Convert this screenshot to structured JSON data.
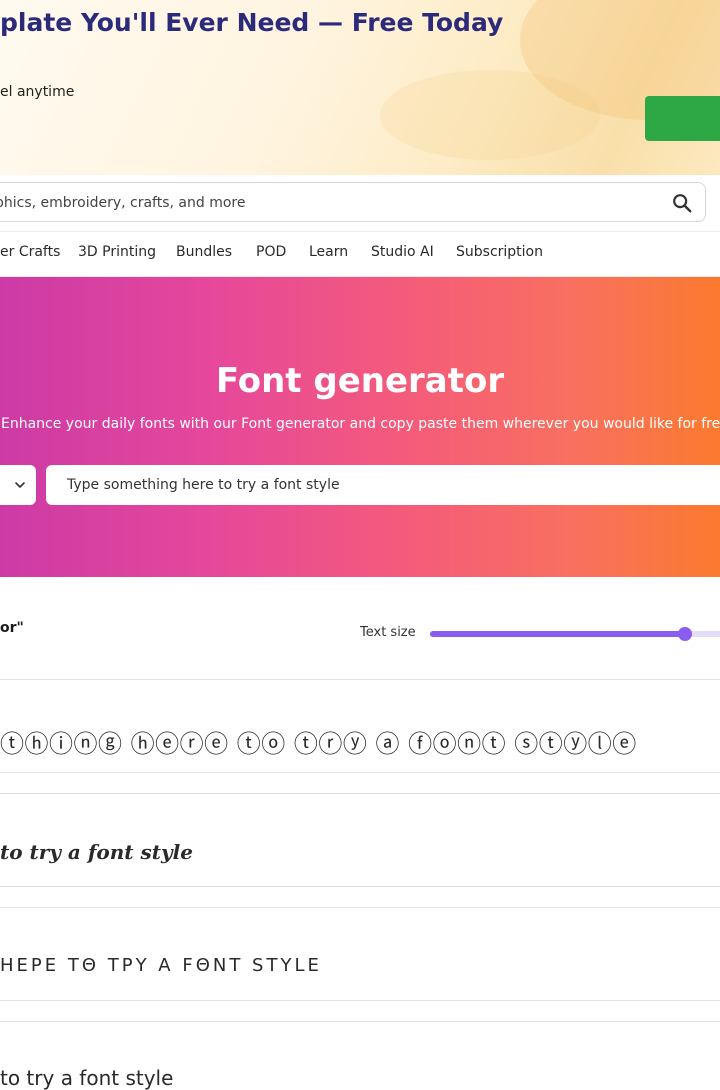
{
  "banner": {
    "title": "plate You'll Ever Need — Free Today",
    "subtitle": "el anytime",
    "cta_color": "#2ea845"
  },
  "search": {
    "placeholder": "phics, embroidery, crafts, and more",
    "icon": "search-icon"
  },
  "nav": {
    "items": [
      {
        "label": "er Crafts"
      },
      {
        "label": "3D Printing"
      },
      {
        "label": "Bundles"
      },
      {
        "label": "POD"
      },
      {
        "label": "Learn"
      },
      {
        "label": "Studio AI"
      },
      {
        "label": "Subscription"
      }
    ]
  },
  "hero": {
    "title": "Font generator",
    "description": "Enhance your daily fonts with our Font generator and copy paste them wherever you would like for free",
    "text_input_placeholder": "Type something here to try a font style",
    "gradient_colors": [
      "#cd3aa6",
      "#f45a7c",
      "#fb7a2e"
    ]
  },
  "results": {
    "label": "or\"",
    "text_size_label": "Text size",
    "text_size_value": 0.85,
    "accent": "#8a5cf0"
  },
  "samples": [
    "ⓣⓗⓘⓝⓖ ⓗⓔⓡⓔ ⓣⓞ ⓣⓡⓨ ⓐ ⓕⓞⓝⓣ ⓢⓣⓨⓛⓔ",
    "to try a font style",
    "ΗΕΡΕ ΤΘ ΤΡΥ Α FΘΝΤ SΤΥLΕ",
    "to try a font style"
  ]
}
